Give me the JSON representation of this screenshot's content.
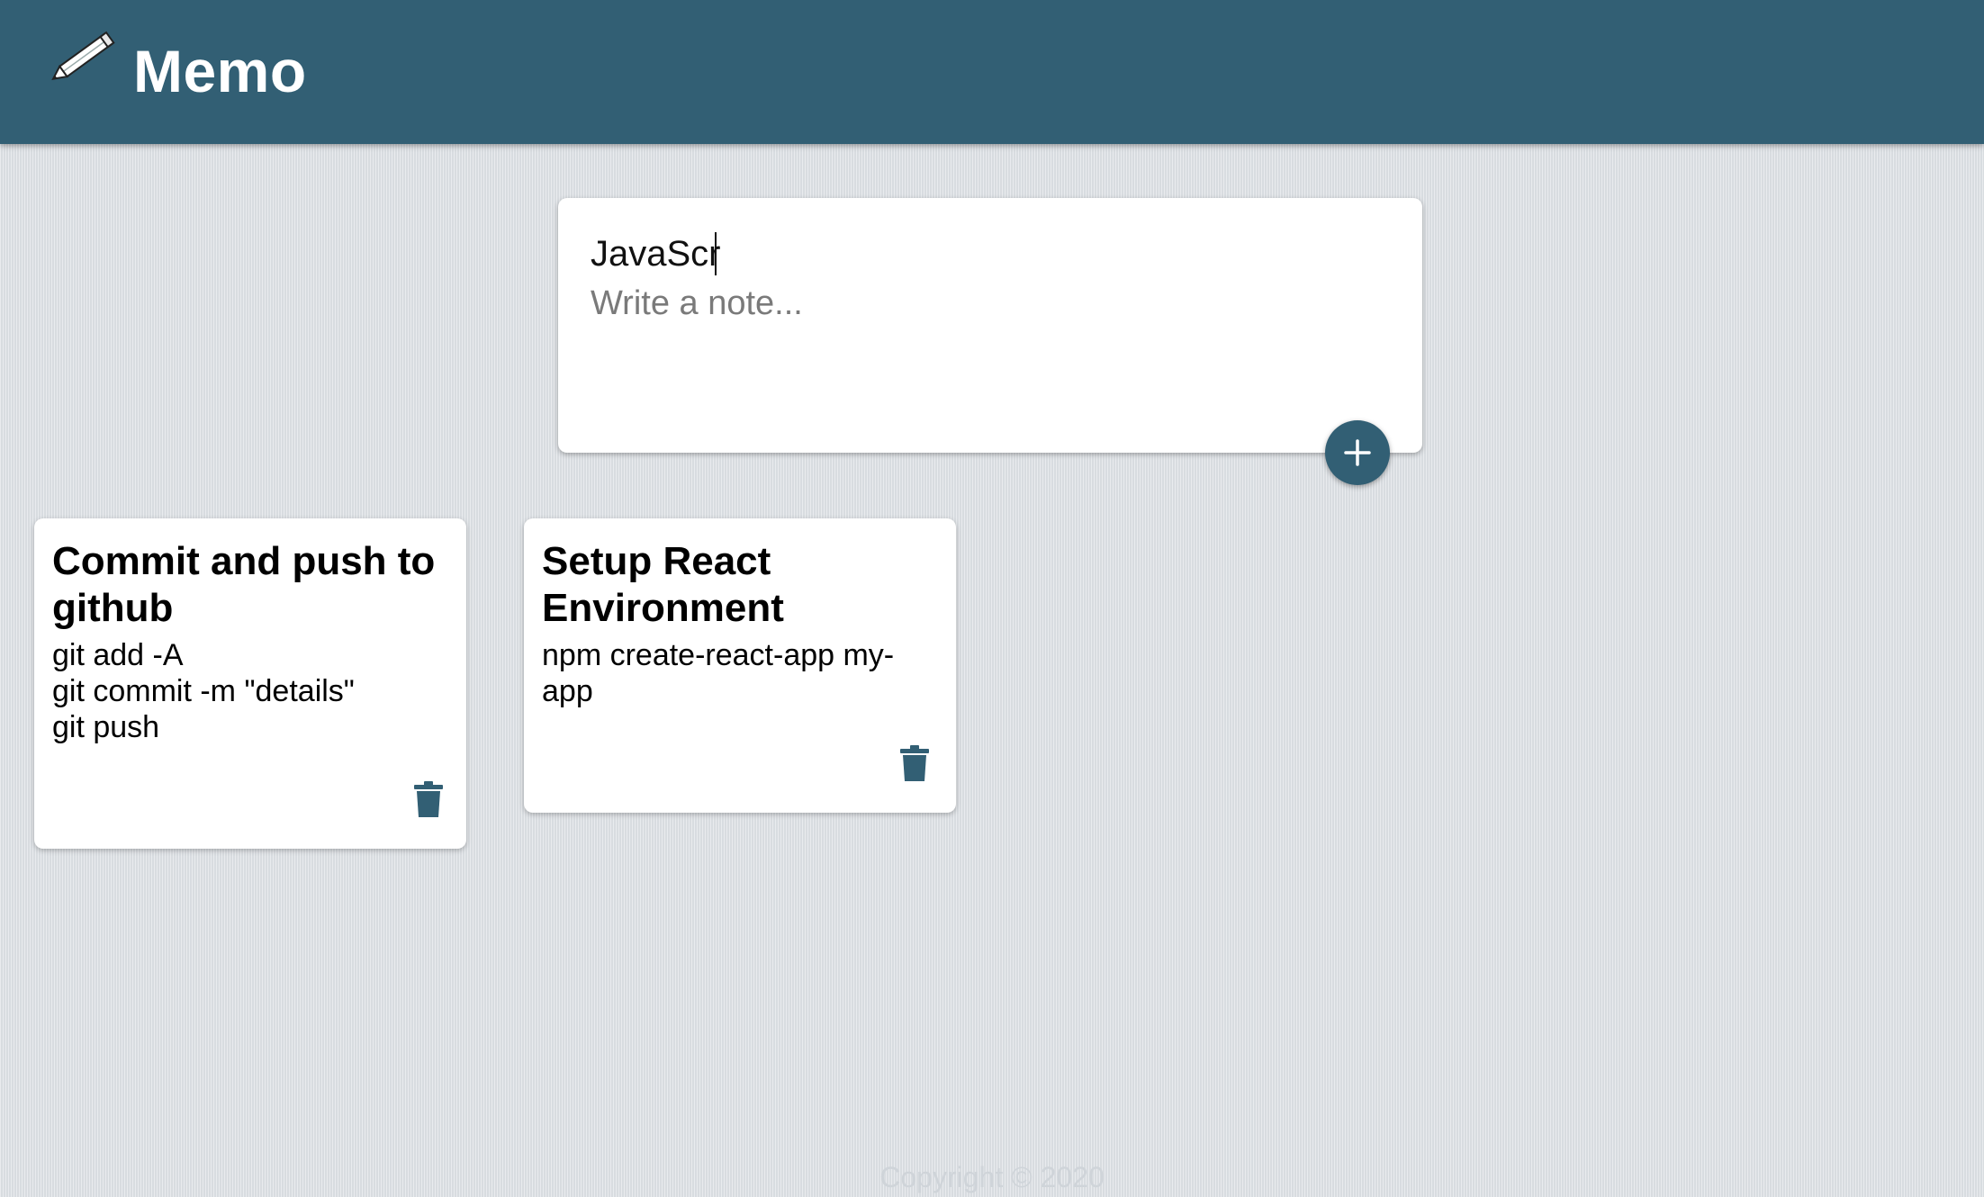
{
  "header": {
    "title": "Memo",
    "icon": "pencil-icon"
  },
  "composer": {
    "title_value": "JavaScr",
    "content_placeholder": "Write a note...",
    "add_icon": "plus-icon"
  },
  "notes": [
    {
      "title": "Commit and push to github",
      "content": "git add -A\ngit commit -m \"details\"\ngit push",
      "delete_icon": "trash-icon"
    },
    {
      "title": "Setup React Environment",
      "content": "npm create-react-app my-app",
      "delete_icon": "trash-icon"
    }
  ],
  "footer": {
    "text": "Copyright © 2020"
  },
  "colors": {
    "brand": "#325f74",
    "background": "#dde1e5",
    "card": "#ffffff"
  }
}
